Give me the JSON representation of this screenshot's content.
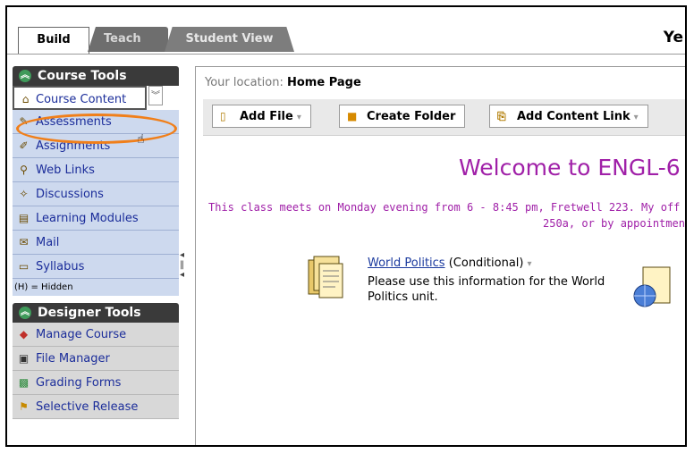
{
  "tabs": [
    {
      "label": "Build"
    },
    {
      "label": "Teach"
    },
    {
      "label": "Student View"
    }
  ],
  "header": {
    "trailing_text": "Ye"
  },
  "course_tools": {
    "title": "Course Tools",
    "items": [
      {
        "label": "Course Content"
      },
      {
        "label": "Assessments"
      },
      {
        "label": "Assignments"
      },
      {
        "label": "Web Links"
      },
      {
        "label": "Discussions"
      },
      {
        "label": "Learning Modules"
      },
      {
        "label": "Mail"
      },
      {
        "label": "Syllabus"
      }
    ],
    "hidden_note": "(H) = Hidden"
  },
  "designer_tools": {
    "title": "Designer Tools",
    "items": [
      {
        "label": "Manage Course"
      },
      {
        "label": "File Manager"
      },
      {
        "label": "Grading Forms"
      },
      {
        "label": "Selective Release"
      }
    ]
  },
  "main": {
    "location_label": "Your location:",
    "location_value": "Home Page",
    "toolbar": {
      "add_file": "Add File",
      "create_folder": "Create Folder",
      "add_content_link": "Add Content Link"
    },
    "welcome": "Welcome to ENGL-6",
    "notice_line1": "This class meets on Monday evening from 6 - 8:45 pm, Fretwell 223. My off",
    "notice_line2": "250a, or by appointmen",
    "content_item": {
      "title": "World Politics",
      "status": "(Conditional)",
      "description": "Please use this information for the World Politics unit."
    }
  },
  "colors": {
    "accent_purple": "#a020a8",
    "highlight_oval": "#f07f1a",
    "sidebar_blue": "#cdd9ee",
    "link_blue": "#1b2d9a"
  }
}
